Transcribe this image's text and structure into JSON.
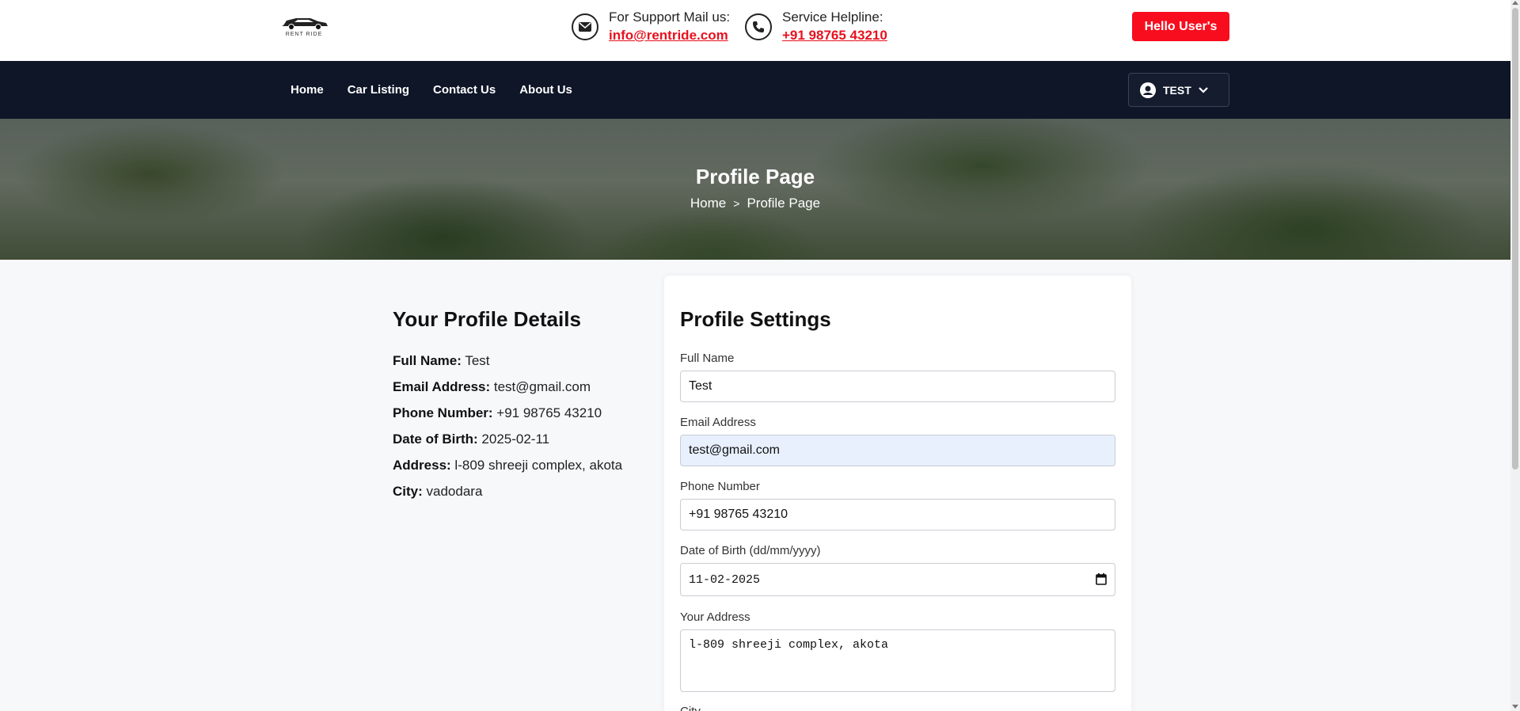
{
  "header": {
    "logo_text": "RENT RIDE",
    "support_label": "For Support Mail us:",
    "support_email": "info@rentride.com",
    "helpline_label": "Service Helpline:",
    "helpline_phone": "+91 98765 43210",
    "hello_button": "Hello User's",
    "accent_color": "#f80d1e"
  },
  "nav": {
    "items": [
      {
        "label": "Home"
      },
      {
        "label": "Car Listing"
      },
      {
        "label": "Contact Us"
      },
      {
        "label": "About Us"
      }
    ],
    "user_name": "TEST",
    "user_icon": "user-circle-icon",
    "dropdown_icon": "chevron-down-icon"
  },
  "hero": {
    "title": "Profile Page",
    "breadcrumb_home": "Home",
    "breadcrumb_sep": ">",
    "breadcrumb_current": "Profile Page"
  },
  "details": {
    "heading": "Your Profile Details",
    "rows": [
      {
        "label": "Full Name:",
        "value": "Test"
      },
      {
        "label": "Email Address:",
        "value": "test@gmail.com"
      },
      {
        "label": "Phone Number:",
        "value": "+91 98765 43210"
      },
      {
        "label": "Date of Birth:",
        "value": "2025-02-11"
      },
      {
        "label": "Address:",
        "value": "l-809 shreeji complex, akota"
      },
      {
        "label": "City:",
        "value": "vadodara"
      }
    ]
  },
  "settings": {
    "heading": "Profile Settings",
    "full_name_label": "Full Name",
    "full_name_value": "Test",
    "email_label": "Email Address",
    "email_value": "test@gmail.com",
    "phone_label": "Phone Number",
    "phone_value": "+91 98765 43210",
    "dob_label": "Date of Birth (dd/mm/yyyy)",
    "dob_value": "11-02-2025",
    "address_label": "Your Address",
    "address_value": "l-809 shreeji complex, akota",
    "city_label": "City"
  }
}
